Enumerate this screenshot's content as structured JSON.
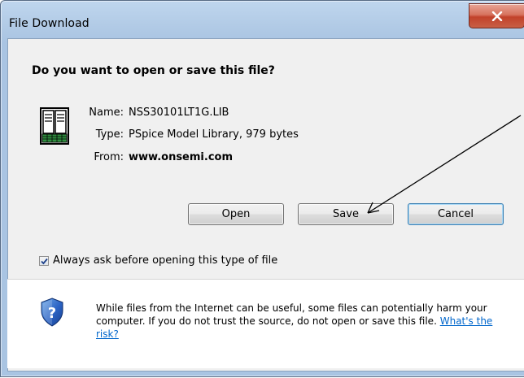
{
  "window": {
    "title": "File Download"
  },
  "dialog": {
    "question": "Do you want to open or save this file?",
    "file": {
      "name_label": "Name:",
      "name_value": "NSS30101LT1G.LIB",
      "type_label": "Type:",
      "type_value": "PSpice Model Library, 979 bytes",
      "from_label": "From:",
      "from_value": "www.onsemi.com"
    },
    "buttons": {
      "open": "Open",
      "save": "Save",
      "cancel": "Cancel"
    },
    "checkbox": {
      "label": "Always ask before opening this type of file",
      "checked": true
    },
    "warning": {
      "text": "While files from the Internet can be useful, some files can potentially harm your computer. If you do not trust the source, do not open or save this file.",
      "link": "What's the risk?"
    }
  },
  "icons": {
    "close": "close-icon",
    "file": "library-file-icon",
    "shield": "security-shield-question-icon",
    "check": "checkmark-icon"
  },
  "colors": {
    "close_button": "#c7432b",
    "link": "#0066cc",
    "title_bar": "#b2cbe6"
  }
}
